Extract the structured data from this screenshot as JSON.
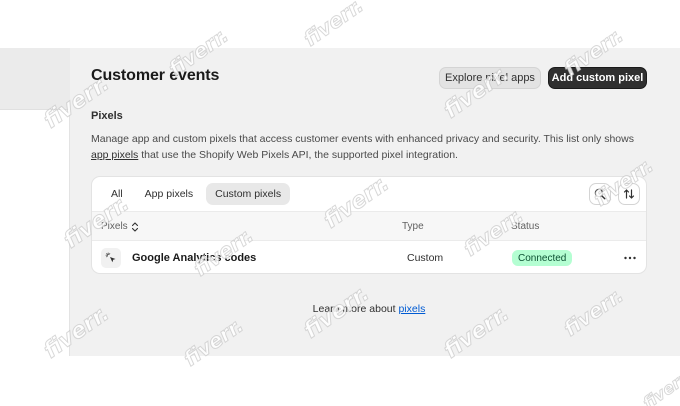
{
  "header": {
    "title": "Customer events",
    "explore_button": "Explore pixel apps",
    "add_button": "Add custom pixel"
  },
  "pixels_section": {
    "heading": "Pixels",
    "description_part1": "Manage app and custom pixels that access customer events with enhanced privacy and security. This list only shows ",
    "description_link": "app pixels",
    "description_part2": " that use the Shopify Web Pixels API, the supported pixel integration."
  },
  "tabs": [
    {
      "label": "All",
      "active": false
    },
    {
      "label": "App pixels",
      "active": false
    },
    {
      "label": "Custom pixels",
      "active": true
    }
  ],
  "table": {
    "columns": [
      "Pixels",
      "Type",
      "Status"
    ],
    "rows": [
      {
        "name": "Google Analytics codes",
        "type": "Custom",
        "status": "Connected"
      }
    ]
  },
  "footer": {
    "learn_text": "Learn more about ",
    "learn_link": "pixels"
  },
  "watermark": "fiverr.",
  "colors": {
    "primary_button": "#303030",
    "status_badge_bg": "#b4fed2",
    "status_badge_text": "#0c5132",
    "link": "#005bd3"
  },
  "icons": {
    "search": "search-icon",
    "sort": "sort-icon",
    "column_sort": "chevron-up-down-icon",
    "pixel": "cursor-click-icon",
    "more": "ellipsis-icon"
  }
}
